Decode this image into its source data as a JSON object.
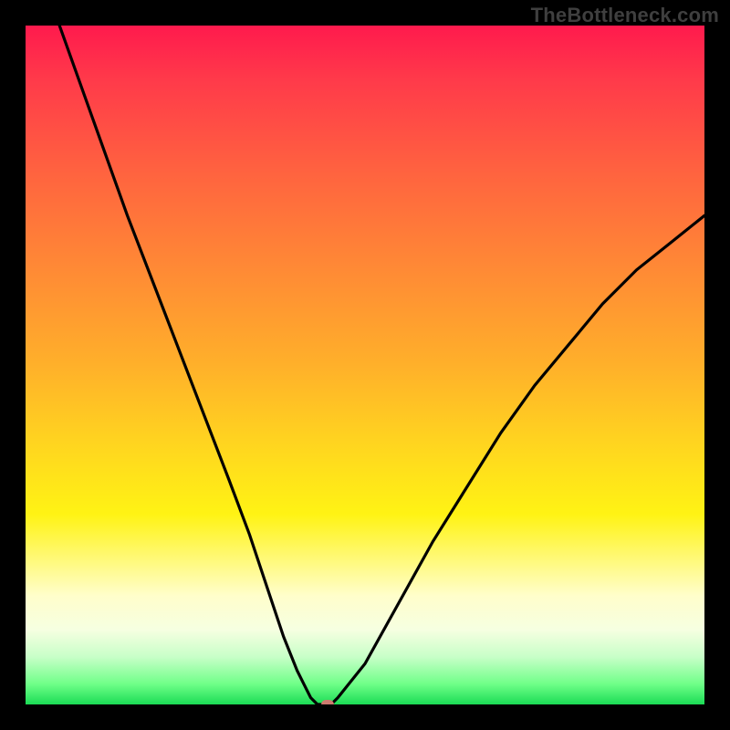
{
  "watermark": "TheBottleneck.com",
  "chart_data": {
    "type": "line",
    "title": "",
    "xlabel": "",
    "ylabel": "",
    "xlim": [
      0,
      100
    ],
    "ylim": [
      0,
      100
    ],
    "series": [
      {
        "name": "curve",
        "x": [
          5,
          10,
          15,
          20,
          25,
          30,
          33,
          36,
          38,
          40,
          41,
          42,
          43,
          44,
          45,
          46,
          50,
          55,
          60,
          65,
          70,
          75,
          80,
          85,
          90,
          95,
          100
        ],
        "y": [
          100,
          86,
          72,
          59,
          46,
          33,
          25,
          16,
          10,
          5,
          3,
          1,
          0,
          0,
          0,
          1,
          6,
          15,
          24,
          32,
          40,
          47,
          53,
          59,
          64,
          68,
          72
        ]
      }
    ],
    "marker": {
      "x": 44.5,
      "y": 0
    },
    "background_gradient": {
      "stops": [
        {
          "pos": 0.0,
          "color": "#ff1a4d"
        },
        {
          "pos": 0.5,
          "color": "#ffb02a"
        },
        {
          "pos": 0.72,
          "color": "#fff314"
        },
        {
          "pos": 0.89,
          "color": "#f6ffe1"
        },
        {
          "pos": 1.0,
          "color": "#1bdc55"
        }
      ]
    }
  }
}
